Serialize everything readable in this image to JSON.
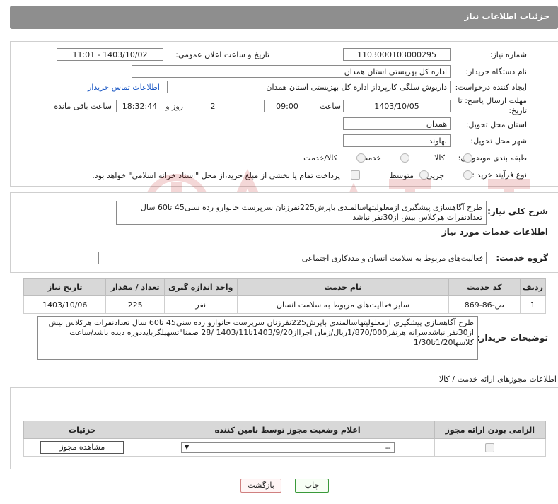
{
  "header": {
    "title": "جزئیات اطلاعات نیاز"
  },
  "form": {
    "need_number_label": "شماره نیاز:",
    "need_number": "1103000103000295",
    "announce_label": "تاریخ و ساعت اعلان عمومی:",
    "announce_value": "1403/10/02 - 11:01",
    "buyer_org_label": "نام دستگاه خریدار:",
    "buyer_org": "اداره کل بهزیستی استان همدان",
    "creator_label": "ایجاد کننده درخواست:",
    "creator": "داریوش سلگی کارپرداز اداره کل بهزیستی استان همدان",
    "contact_link": "اطلاعات تماس خریدار",
    "deadline_label": "مهلت ارسال پاسخ: تا تاریخ:",
    "deadline_date": "1403/10/05",
    "time_label": "ساعت",
    "deadline_time": "09:00",
    "days_value": "2",
    "days_label": "روز و",
    "remaining_time": "18:32:44",
    "remaining_label": "ساعت باقی مانده",
    "province_label": "استان محل تحویل:",
    "province": "همدان",
    "city_label": "شهر محل تحویل:",
    "city": "نهاوند",
    "category_label": "طبقه بندی موضوعی:",
    "category_options": [
      "کالا",
      "خدمت",
      "کالا/خدمت"
    ],
    "process_label": "نوع فرآیند خرید :",
    "process_options": [
      "جزیی",
      "متوسط"
    ],
    "payment_note": "پرداخت تمام یا بخشی از مبلغ خرید،از محل \"اسناد خزانه اسلامی\" خواهد بود."
  },
  "summary": {
    "label": "شرح کلی نیاز:",
    "text": "طرح آگاهسازی پیشگیری ازمعلولیتهاسالمندی باپرش225نفرزنان سرپرست خانوارو رده سنی45 تا60 سال تعدادنفرات هرکلاس بیش از30نفر نباشد"
  },
  "services": {
    "heading": "اطلاعات خدمات مورد نیاز",
    "group_label": "گروه خدمت:",
    "group_value": "فعالیت‌های مربوط به سلامت انسان و مددکاری اجتماعی",
    "columns": [
      "ردیف",
      "کد خدمت",
      "نام خدمت",
      "واحد اندازه گیری",
      "تعداد / مقدار",
      "تاریخ نیاز"
    ],
    "rows": [
      [
        "1",
        "ص-86-869",
        "سایر فعالیت‌های مربوط به سلامت انسان",
        "نفر",
        "225",
        "1403/10/06"
      ]
    ]
  },
  "buyer_notes": {
    "label": "توضیحات خریدار:",
    "text": "طرح آگاهسازی پیشگیری ازمعلولیتهاسالمندی باپرش225نفرزنان سرپرست خانوارو رده سنی45 تا60 سال تعدادنفرات هرکلاس بیش از30نفر نباشدسرانه هرنفر1/870/000ریال/زمان اجرااز1403/9/20تا1403/11 /28 ضمنا\"تسهیلگربایددوره دیده باشد/ساعت کلاسها1/20تا1/30"
  },
  "permits": {
    "heading": "اطلاعات مجوزهای ارائه خدمت / کالا",
    "columns": [
      "الزامی بودن ارائه مجوز",
      "اعلام وضعیت مجوز توسط نامین کننده",
      "جزئیات"
    ],
    "select_value": "--",
    "view_button": "مشاهده مجوز"
  },
  "footer": {
    "print_button": "چاپ",
    "back_button": "بازگشت"
  }
}
